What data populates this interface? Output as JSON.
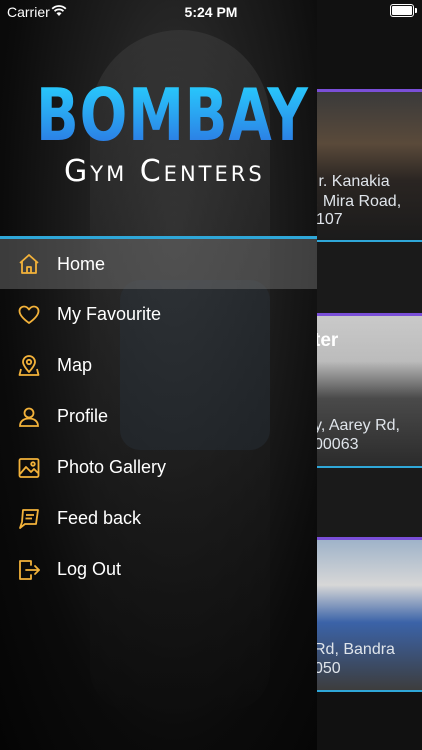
{
  "status_bar": {
    "carrier": "Carrier",
    "time": "5:24 PM"
  },
  "logo": {
    "title": "BOMBAY",
    "subtitle": "Gym Centers"
  },
  "menu": {
    "items": [
      {
        "label": "Home",
        "icon": "home-icon",
        "active": true
      },
      {
        "label": "My Favourite",
        "icon": "heart-icon",
        "active": false
      },
      {
        "label": "Map",
        "icon": "map-pin-icon",
        "active": false
      },
      {
        "label": "Profile",
        "icon": "user-icon",
        "active": false
      },
      {
        "label": "Photo Gallery",
        "icon": "image-icon",
        "active": false
      },
      {
        "label": "Feed back",
        "icon": "feedback-icon",
        "active": false
      },
      {
        "label": "Log Out",
        "icon": "logout-icon",
        "active": false
      }
    ]
  },
  "background_list": {
    "cards": [
      {
        "address_line1": "Ir. Kanakia",
        "address_line2": ", Mira Road,",
        "address_line3": "107"
      },
      {
        "title": "ter",
        "address_line1": "y, Aarey Rd,",
        "address_line2": "00063"
      },
      {
        "address_line1": "Rd, Bandra",
        "address_line2": "050"
      }
    ]
  },
  "colors": {
    "accent_blue": "#2fa7d8",
    "icon_gold": "#f3b23a",
    "card_bar": "#7a4fd8"
  }
}
